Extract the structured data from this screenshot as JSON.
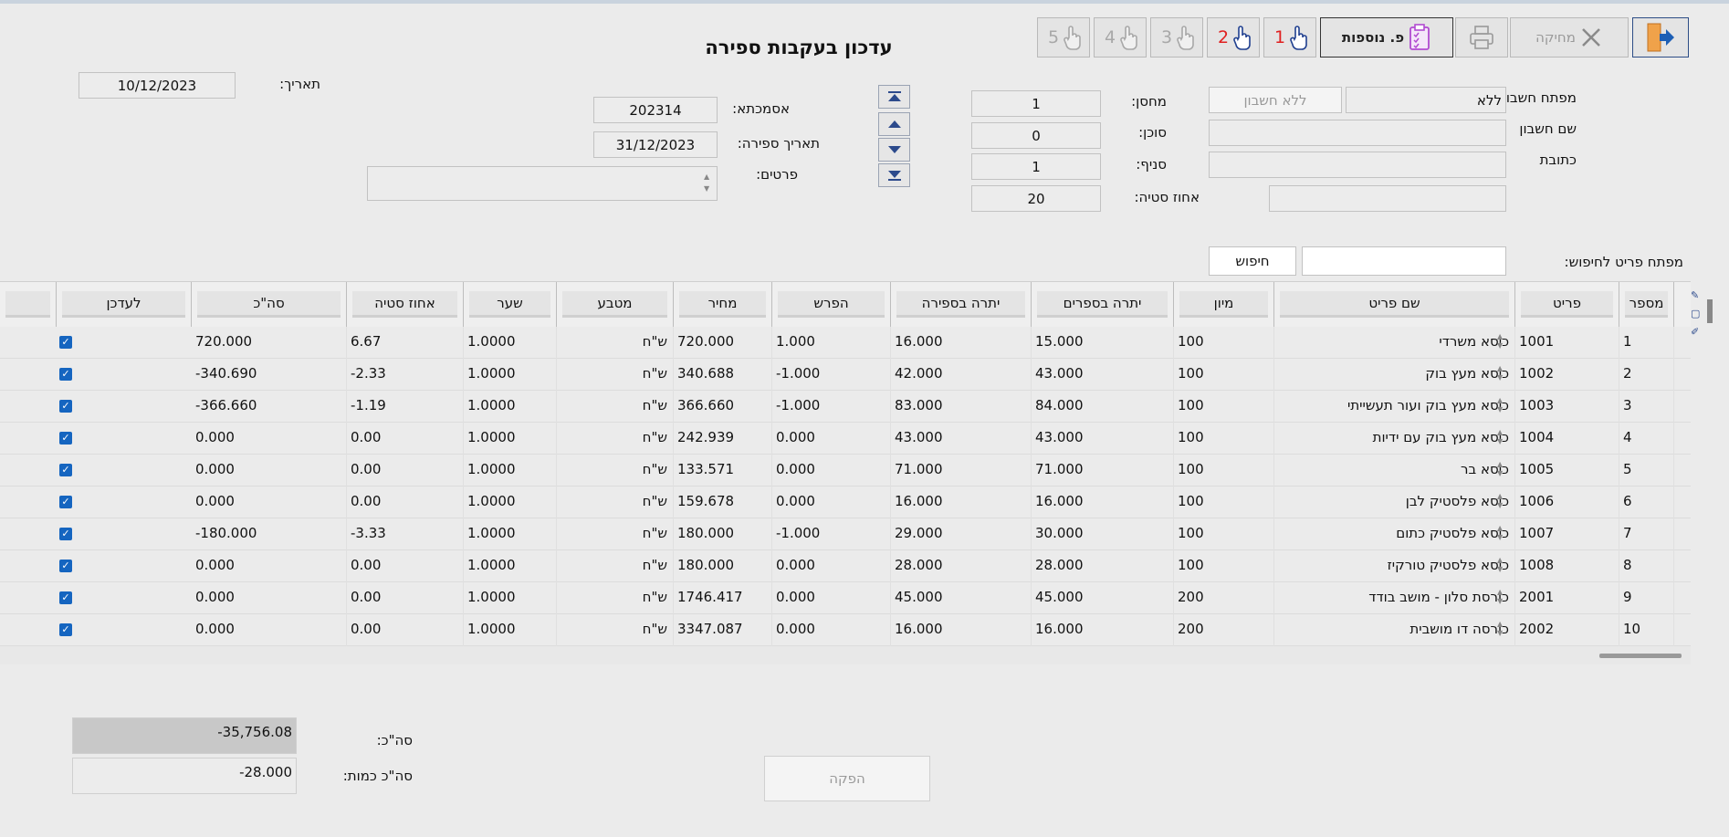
{
  "toolbar": {
    "exit_icon": "exit-door-icon",
    "delete_label": "מחיקה",
    "print_icon": "printer-icon",
    "extra_label": "פ. נוספות",
    "hand_buttons": [
      "1",
      "2",
      "3",
      "4",
      "5"
    ]
  },
  "title": "עדכון בעקבות ספירה",
  "header": {
    "account_key_label": "מפתח חשבון",
    "account_key_value": "ללא",
    "account_key_hint": "ללא חשבון",
    "account_name_label": "שם חשבון",
    "address_label": "כתובת",
    "warehouse_label": "מחסן:",
    "warehouse_value": "1",
    "agent_label": "סוכן:",
    "agent_value": "0",
    "branch_label": "סניף:",
    "branch_value": "1",
    "deviation_label": "אחוז סטיה:",
    "deviation_value": "20",
    "reference_label": "אסמכתא:",
    "reference_value": "202314",
    "count_date_label": "תאריך ספירה:",
    "count_date_value": "31/12/2023",
    "details_label": "פרטים:",
    "date_label": "תאריך:",
    "date_value": "10/12/2023"
  },
  "search": {
    "label": "מפתח פריט לחיפוש:",
    "button": "חיפוש"
  },
  "table": {
    "columns": [
      "מספר",
      "פריט",
      "שם פריט",
      "מיון",
      "יתרה בספרים",
      "יתרה בספירה",
      "הפרש",
      "מחיר",
      "מטבע",
      "שער",
      "אחוז סטיה",
      "סה\"כ",
      "לעדכן"
    ],
    "rows": [
      {
        "n": "1",
        "item": "1001",
        "name": "כיסא משרדי",
        "sort": "100",
        "book": "15.000",
        "count": "16.000",
        "diff": "1.000",
        "price": "720.000",
        "cur": "ש\"ח",
        "rate": "1.0000",
        "dev": "6.67",
        "total": "720.000",
        "update": true
      },
      {
        "n": "2",
        "item": "1002",
        "name": "כיסא מעץ בוק",
        "sort": "100",
        "book": "43.000",
        "count": "42.000",
        "diff": "-1.000",
        "price": "340.688",
        "cur": "ש\"ח",
        "rate": "1.0000",
        "dev": "-2.33",
        "total": "-340.690",
        "update": true
      },
      {
        "n": "3",
        "item": "1003",
        "name": "כיסא מעץ בוק ועור תעשייתי",
        "sort": "100",
        "book": "84.000",
        "count": "83.000",
        "diff": "-1.000",
        "price": "366.660",
        "cur": "ש\"ח",
        "rate": "1.0000",
        "dev": "-1.19",
        "total": "-366.660",
        "update": true
      },
      {
        "n": "4",
        "item": "1004",
        "name": "כיסא מעץ בוק עם ידיות",
        "sort": "100",
        "book": "43.000",
        "count": "43.000",
        "diff": "0.000",
        "price": "242.939",
        "cur": "ש\"ח",
        "rate": "1.0000",
        "dev": "0.00",
        "total": "0.000",
        "update": true
      },
      {
        "n": "5",
        "item": "1005",
        "name": "כיסא בר",
        "sort": "100",
        "book": "71.000",
        "count": "71.000",
        "diff": "0.000",
        "price": "133.571",
        "cur": "ש\"ח",
        "rate": "1.0000",
        "dev": "0.00",
        "total": "0.000",
        "update": true
      },
      {
        "n": "6",
        "item": "1006",
        "name": "כיסא פלסטיק לבן",
        "sort": "100",
        "book": "16.000",
        "count": "16.000",
        "diff": "0.000",
        "price": "159.678",
        "cur": "ש\"ח",
        "rate": "1.0000",
        "dev": "0.00",
        "total": "0.000",
        "update": true
      },
      {
        "n": "7",
        "item": "1007",
        "name": "כיסא פלסטיק כתום",
        "sort": "100",
        "book": "30.000",
        "count": "29.000",
        "diff": "-1.000",
        "price": "180.000",
        "cur": "ש\"ח",
        "rate": "1.0000",
        "dev": "-3.33",
        "total": "-180.000",
        "update": true
      },
      {
        "n": "8",
        "item": "1008",
        "name": "כיסא פלסטיק טורקיז",
        "sort": "100",
        "book": "28.000",
        "count": "28.000",
        "diff": "0.000",
        "price": "180.000",
        "cur": "ש\"ח",
        "rate": "1.0000",
        "dev": "0.00",
        "total": "0.000",
        "update": true
      },
      {
        "n": "9",
        "item": "2001",
        "name": "כורסת סלון - מושב בודד",
        "sort": "200",
        "book": "45.000",
        "count": "45.000",
        "diff": "0.000",
        "price": "1746.417",
        "cur": "ש\"ח",
        "rate": "1.0000",
        "dev": "0.00",
        "total": "0.000",
        "update": true
      },
      {
        "n": "10",
        "item": "2002",
        "name": "כורסה דו מושבית",
        "sort": "200",
        "book": "16.000",
        "count": "16.000",
        "diff": "0.000",
        "price": "3347.087",
        "cur": "ש\"ח",
        "rate": "1.0000",
        "dev": "0.00",
        "total": "0.000",
        "update": true
      }
    ]
  },
  "totals": {
    "total_label": "סה\"כ:",
    "total_value": "-35,756.08",
    "qty_label": "סה\"כ כמות:",
    "qty_value": "-28.000"
  },
  "produce_button": "הפקה"
}
